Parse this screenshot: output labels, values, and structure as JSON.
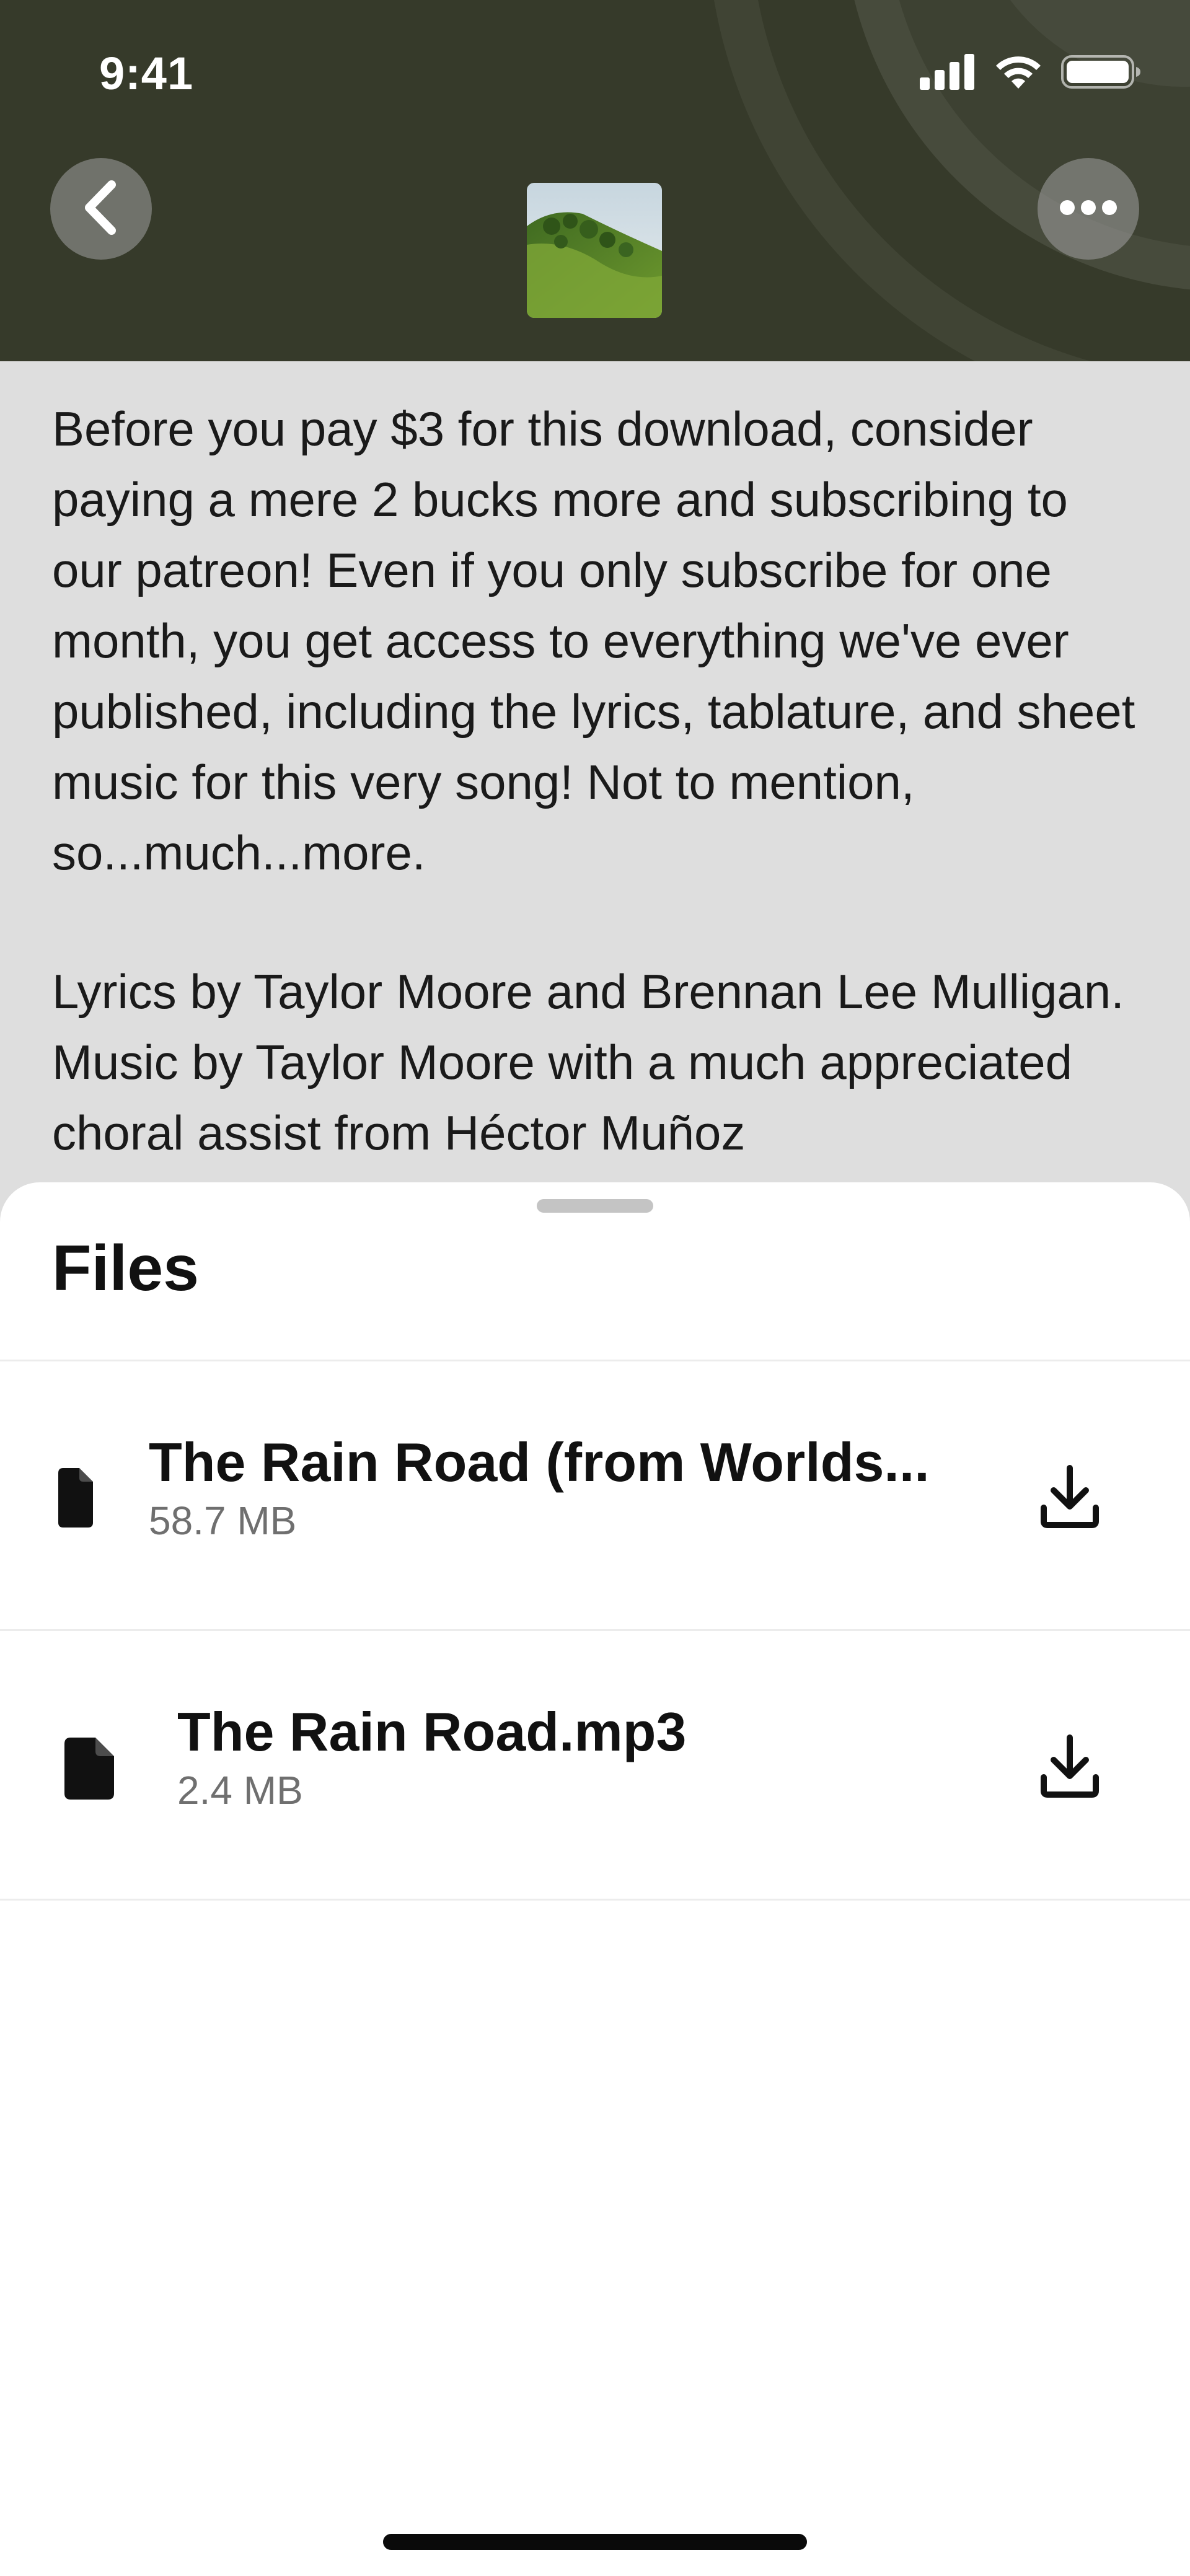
{
  "status_bar": {
    "time": "9:41",
    "icons": [
      "cellular-signal-icon",
      "wifi-icon",
      "battery-icon"
    ]
  },
  "header": {
    "back_icon": "chevron-left-icon",
    "more_icon": "ellipsis-icon",
    "background_color": "#363a2a"
  },
  "description": {
    "paragraphs": [
      "Before you pay $3 for this download, consider paying a mere 2 bucks more and subscribing to our patreon! Even if you only subscribe for one month, you get access to everything we've ever published, including the lyrics, tablature, and sheet music for this very song! Not to mention, so...much...more.",
      "Lyrics by Taylor Moore and Brennan Lee Mulligan. Music by Taylor Moore with a much appreciated choral assist from Héctor Muñoz"
    ]
  },
  "files_sheet": {
    "title": "Files",
    "files": [
      {
        "name": "The Rain Road (from Worlds...",
        "size": "58.7 MB",
        "icon": "file-icon",
        "action_icon": "download-icon"
      },
      {
        "name": "The Rain Road.mp3",
        "size": "2.4 MB",
        "icon": "file-icon",
        "action_icon": "download-icon"
      }
    ]
  },
  "colors": {
    "accent_text": "#111111",
    "secondary_text": "#6f6f6f",
    "sheet_background": "#ffffff",
    "page_background": "#dedede"
  }
}
